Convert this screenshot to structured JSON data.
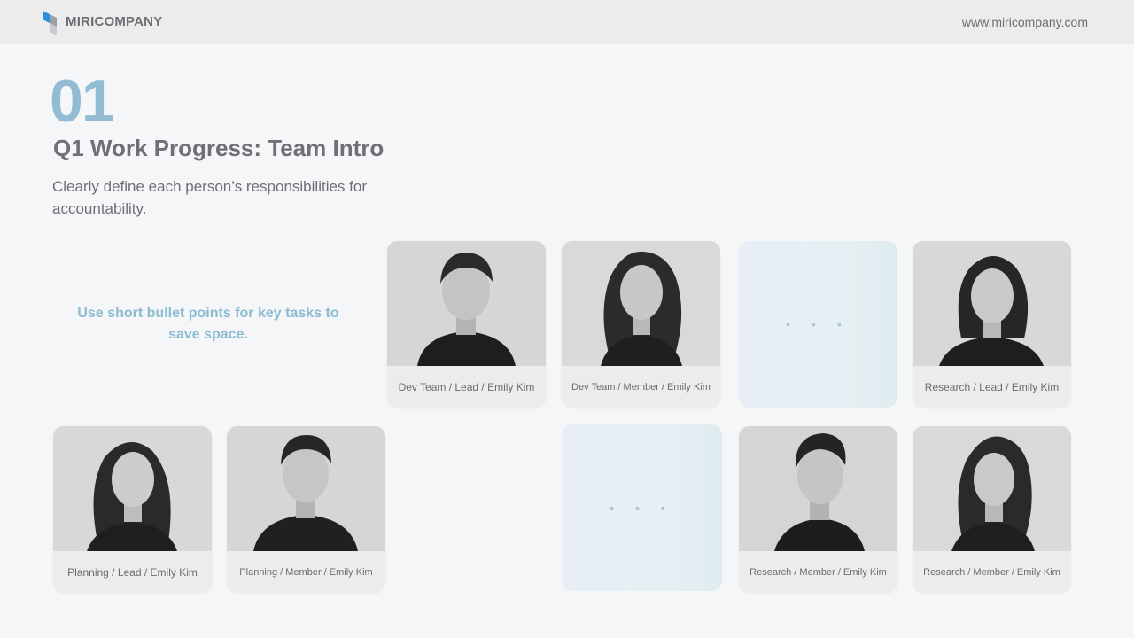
{
  "header": {
    "brand": "MIRICOMPANY",
    "url": "www.miricompany.com"
  },
  "slide": {
    "number": "01",
    "title": "Q1 Work Progress: Team Intro",
    "subtitle": "Clearly define each person’s responsibilities for accountability.",
    "note": "Use short bullet points for key tasks to save space."
  },
  "cards": [
    {
      "caption": "Dev Team / Lead / Emily Kim"
    },
    {
      "caption": "Dev Team / Member / Emily Kim"
    },
    {
      "caption": "Research / Lead / Emily Kim"
    },
    {
      "caption": "Planning / Lead / Emily Kim"
    },
    {
      "caption": "Planning / Member / Emily Kim"
    },
    {
      "caption": "Research / Member / Emily Kim"
    },
    {
      "caption": "Research / Member / Emily Kim"
    }
  ],
  "placeholders": [
    {
      "text": "• • •"
    },
    {
      "text": "• • •"
    }
  ],
  "colors": {
    "accent": "#93bcd4",
    "logo_blue": "#2a8fd6",
    "background": "#f4f6f8"
  }
}
